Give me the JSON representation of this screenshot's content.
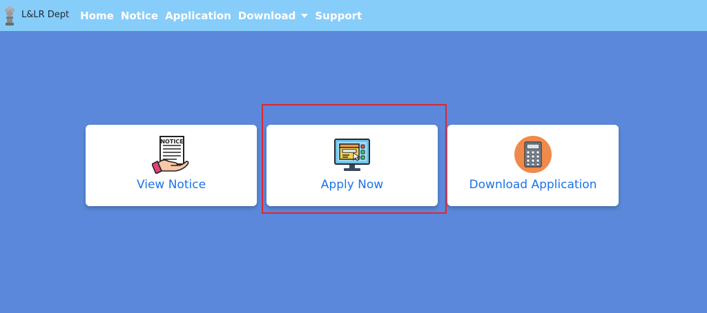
{
  "navbar": {
    "brand": "L&LR Dept",
    "links": [
      {
        "label": "Home"
      },
      {
        "label": "Notice"
      },
      {
        "label": "Application"
      },
      {
        "label": "Download",
        "dropdown": true
      },
      {
        "label": "Support"
      }
    ]
  },
  "cards": [
    {
      "label": "View Notice",
      "icon": "notice-hand-icon",
      "notice_text": "NOTICE"
    },
    {
      "label": "Apply Now",
      "icon": "computer-form-icon"
    },
    {
      "label": "Download Application",
      "icon": "calculator-icon"
    }
  ],
  "colors": {
    "background": "#5b88da",
    "navbar": "#87cdfa",
    "card_label": "#1a73e8",
    "highlight": "#e0252f"
  }
}
